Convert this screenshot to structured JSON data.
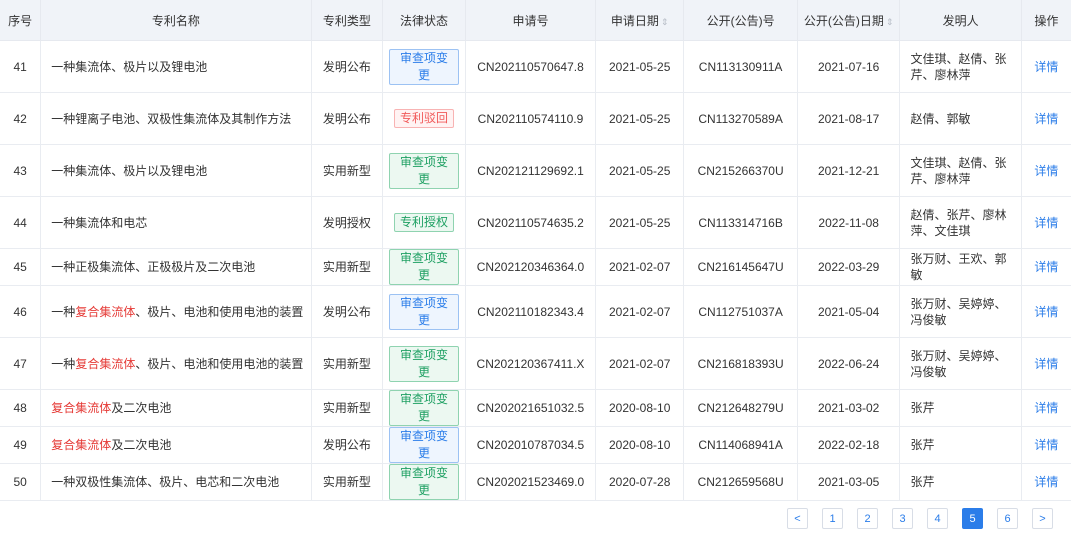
{
  "columns": [
    "序号",
    "专利名称",
    "专利类型",
    "法律状态",
    "申请号",
    "申请日期",
    "公开(公告)号",
    "公开(公告)日期",
    "发明人",
    "操作"
  ],
  "rows": [
    {
      "no": "41",
      "name": [
        {
          "t": "一种集流体、极片以及锂电池",
          "hl": false
        }
      ],
      "type": "发明公布",
      "status": "审查项变更",
      "status_color": "blue",
      "app_no": "CN202110570647.8",
      "app_date": "2021-05-25",
      "pub_no": "CN113130911A",
      "pub_date": "2021-07-16",
      "inventors": "文佳琪、赵倩、张芹、廖林萍",
      "action": "详情"
    },
    {
      "no": "42",
      "name": [
        {
          "t": "一种锂离子电池、双极性集流体及其制作方法",
          "hl": false
        }
      ],
      "type": "发明公布",
      "status": "专利驳回",
      "status_color": "red",
      "app_no": "CN202110574110.9",
      "app_date": "2021-05-25",
      "pub_no": "CN113270589A",
      "pub_date": "2021-08-17",
      "inventors": "赵倩、郭敏",
      "action": "详情"
    },
    {
      "no": "43",
      "name": [
        {
          "t": "一种集流体、极片以及锂电池",
          "hl": false
        }
      ],
      "type": "实用新型",
      "status": "审查项变更",
      "status_color": "green",
      "app_no": "CN202121129692.1",
      "app_date": "2021-05-25",
      "pub_no": "CN215266370U",
      "pub_date": "2021-12-21",
      "inventors": "文佳琪、赵倩、张芹、廖林萍",
      "action": "详情"
    },
    {
      "no": "44",
      "name": [
        {
          "t": "一种集流体和电芯",
          "hl": false
        }
      ],
      "type": "发明授权",
      "status": "专利授权",
      "status_color": "green",
      "app_no": "CN202110574635.2",
      "app_date": "2021-05-25",
      "pub_no": "CN113314716B",
      "pub_date": "2022-11-08",
      "inventors": "赵倩、张芹、廖林萍、文佳琪",
      "action": "详情"
    },
    {
      "no": "45",
      "name": [
        {
          "t": "一种正极集流体、正极极片及二次电池",
          "hl": false
        }
      ],
      "type": "实用新型",
      "status": "审查项变更",
      "status_color": "green",
      "app_no": "CN202120346364.0",
      "app_date": "2021-02-07",
      "pub_no": "CN216145647U",
      "pub_date": "2022-03-29",
      "inventors": "张万财、王欢、郭敏",
      "action": "详情"
    },
    {
      "no": "46",
      "name": [
        {
          "t": "一种",
          "hl": false
        },
        {
          "t": "复合集流体",
          "hl": true
        },
        {
          "t": "、极片、电池和使用电池的装置",
          "hl": false
        }
      ],
      "type": "发明公布",
      "status": "审查项变更",
      "status_color": "blue",
      "app_no": "CN202110182343.4",
      "app_date": "2021-02-07",
      "pub_no": "CN112751037A",
      "pub_date": "2021-05-04",
      "inventors": "张万财、吴婷婷、冯俊敏",
      "action": "详情"
    },
    {
      "no": "47",
      "name": [
        {
          "t": "一种",
          "hl": false
        },
        {
          "t": "复合集流体",
          "hl": true
        },
        {
          "t": "、极片、电池和使用电池的装置",
          "hl": false
        }
      ],
      "type": "实用新型",
      "status": "审查项变更",
      "status_color": "green",
      "app_no": "CN202120367411.X",
      "app_date": "2021-02-07",
      "pub_no": "CN216818393U",
      "pub_date": "2022-06-24",
      "inventors": "张万财、吴婷婷、冯俊敏",
      "action": "详情"
    },
    {
      "no": "48",
      "name": [
        {
          "t": "复合集流体",
          "hl": true
        },
        {
          "t": "及二次电池",
          "hl": false
        }
      ],
      "type": "实用新型",
      "status": "审查项变更",
      "status_color": "green",
      "app_no": "CN202021651032.5",
      "app_date": "2020-08-10",
      "pub_no": "CN212648279U",
      "pub_date": "2021-03-02",
      "inventors": "张芹",
      "action": "详情"
    },
    {
      "no": "49",
      "name": [
        {
          "t": "复合集流体",
          "hl": true
        },
        {
          "t": "及二次电池",
          "hl": false
        }
      ],
      "type": "发明公布",
      "status": "审查项变更",
      "status_color": "blue",
      "app_no": "CN202010787034.5",
      "app_date": "2020-08-10",
      "pub_no": "CN114068941A",
      "pub_date": "2022-02-18",
      "inventors": "张芹",
      "action": "详情"
    },
    {
      "no": "50",
      "name": [
        {
          "t": "一种双极性集流体、极片、电芯和二次电池",
          "hl": false
        }
      ],
      "type": "实用新型",
      "status": "审查项变更",
      "status_color": "green",
      "app_no": "CN202021523469.0",
      "app_date": "2020-07-28",
      "pub_no": "CN212659568U",
      "pub_date": "2021-03-05",
      "inventors": "张芹",
      "action": "详情"
    }
  ],
  "pagination": {
    "prev": "<",
    "pages": [
      "1",
      "2",
      "3",
      "4",
      "5",
      "6"
    ],
    "current": "5",
    "next": ">"
  }
}
